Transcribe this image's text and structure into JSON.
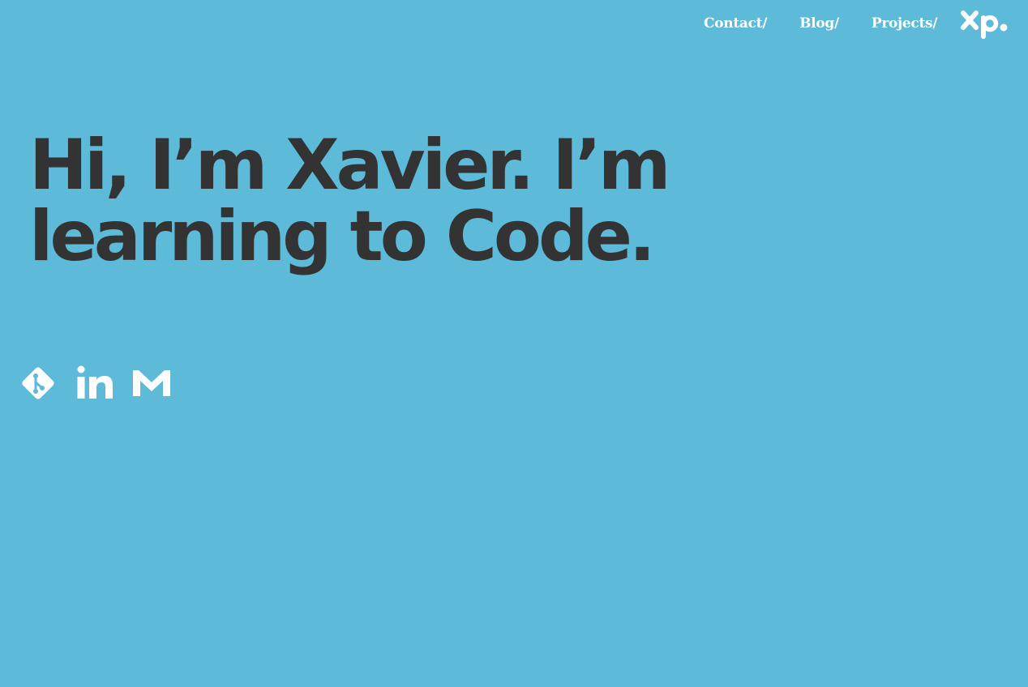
{
  "nav": {
    "items": [
      {
        "label": "Contact/"
      },
      {
        "label": "Blog/"
      },
      {
        "label": "Projects/"
      }
    ]
  },
  "logo": {
    "text": "xp.",
    "icon": "xp-logo"
  },
  "hero": {
    "line1": "Hi, I’m Xavier. I’m",
    "line2": "learning to Code."
  },
  "social": [
    {
      "icon": "git-icon"
    },
    {
      "icon": "linkedin-icon"
    },
    {
      "icon": "gmail-icon"
    }
  ],
  "colors": {
    "background": "#5dbad8",
    "heading": "#333333",
    "accent": "#ffffff"
  }
}
